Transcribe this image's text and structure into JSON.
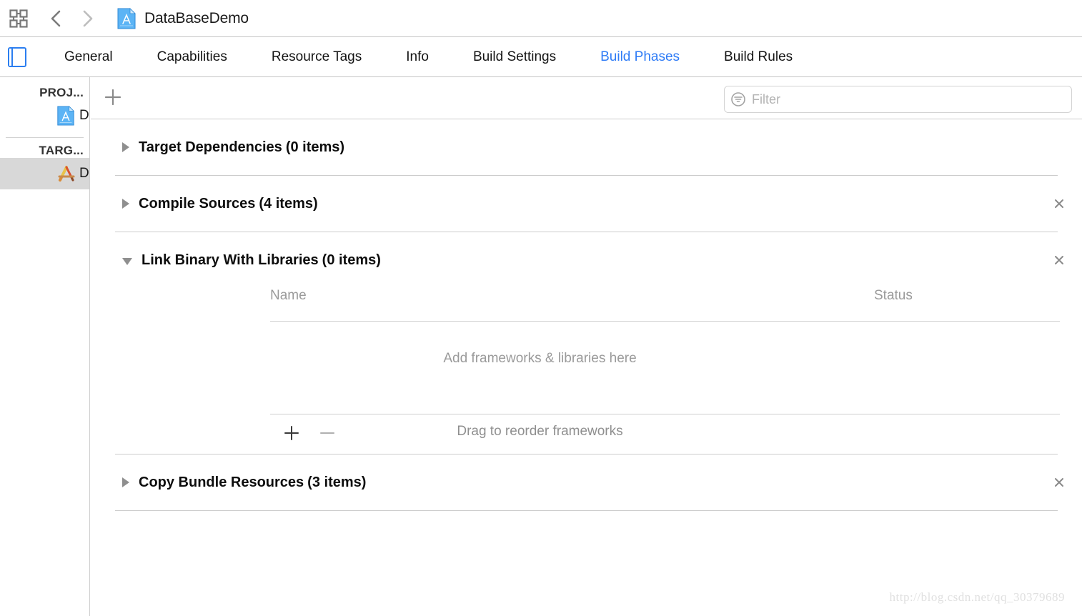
{
  "toolbar": {
    "grid_icon": "grid-icon",
    "back_icon": "chevron-left-icon",
    "forward_icon": "chevron-right-icon",
    "project_icon": "xcode-project-icon",
    "document_title": "DataBaseDemo"
  },
  "tabbar": {
    "sidebar_toggle_icon": "sidebar-toggle-icon",
    "tabs": [
      {
        "label": "General",
        "active": false
      },
      {
        "label": "Capabilities",
        "active": false
      },
      {
        "label": "Resource Tags",
        "active": false
      },
      {
        "label": "Info",
        "active": false
      },
      {
        "label": "Build Settings",
        "active": false
      },
      {
        "label": "Build Phases",
        "active": true
      },
      {
        "label": "Build Rules",
        "active": false
      }
    ],
    "active_color": "#2f7cf6"
  },
  "sidebar": {
    "project_header": "PROJ...",
    "targets_header": "TARG...",
    "project_row": {
      "label": "D",
      "icon": "xcode-project-icon"
    },
    "target_row": {
      "label": "D",
      "icon": "xcode-target-icon",
      "selected": true
    }
  },
  "filterbar": {
    "add_phase_icon": "plus-icon",
    "filter_icon": "filter-icon",
    "filter_placeholder": "Filter",
    "filter_value": ""
  },
  "phases": [
    {
      "title": "Target Dependencies",
      "count": "(0 items)",
      "expanded": false,
      "closable": false,
      "disclosure_icon": "triangle-right-icon"
    },
    {
      "title": "Compile Sources",
      "count": "(4 items)",
      "expanded": false,
      "closable": true,
      "disclosure_icon": "triangle-right-icon",
      "close_icon": "close-icon"
    },
    {
      "title": "Link Binary With Libraries",
      "count": "(0 items)",
      "expanded": true,
      "closable": true,
      "disclosure_icon": "triangle-down-icon",
      "close_icon": "close-icon",
      "columns": {
        "name": "Name",
        "status": "Status"
      },
      "empty_text": "Add frameworks & libraries here",
      "footer": {
        "add_icon": "plus-icon",
        "remove_icon": "minus-icon",
        "hint": "Drag to reorder frameworks"
      }
    },
    {
      "title": "Copy Bundle Resources",
      "count": "(3 items)",
      "expanded": false,
      "closable": true,
      "disclosure_icon": "triangle-right-icon",
      "close_icon": "close-icon"
    }
  ],
  "watermark": "http://blog.csdn.net/qq_30379689"
}
